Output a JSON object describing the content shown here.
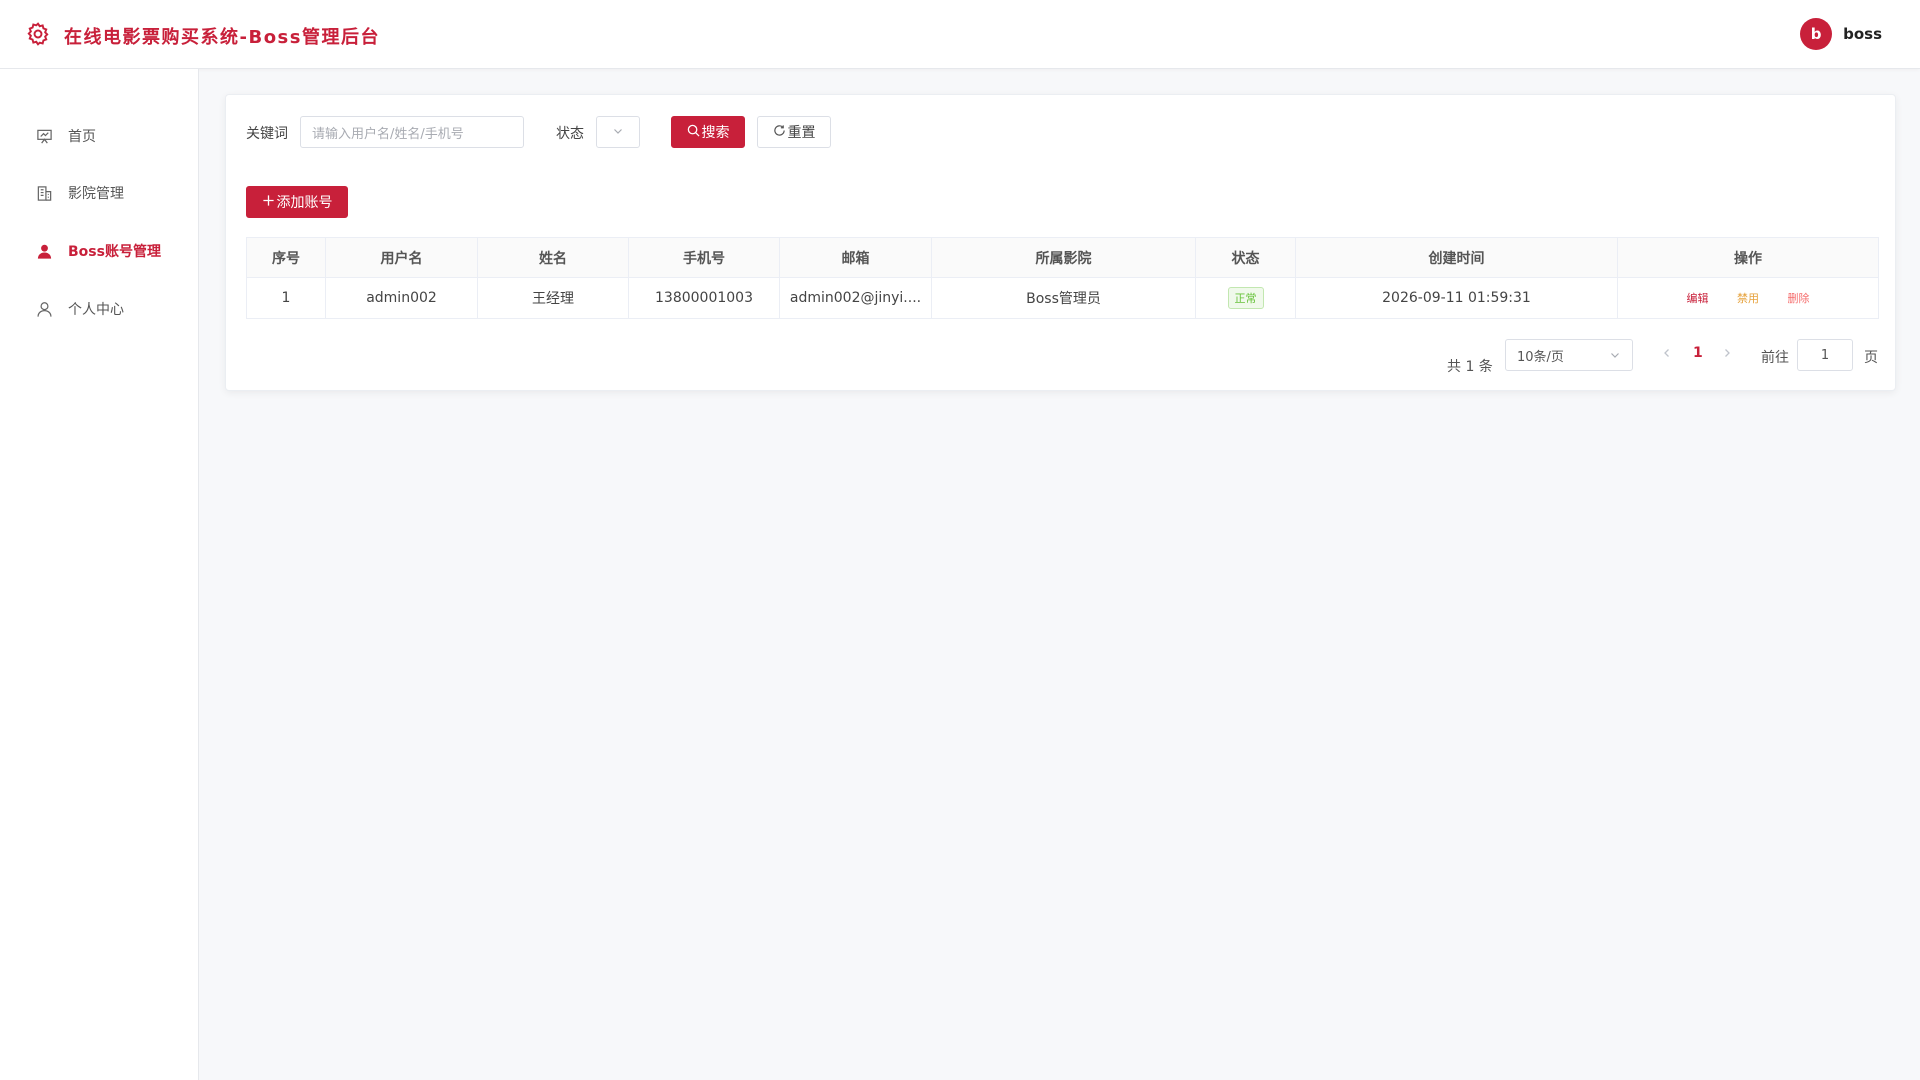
{
  "header": {
    "title": "在线电影票购买系统-Boss管理后台",
    "user": {
      "avatar_letter": "b",
      "name": "boss"
    }
  },
  "sidebar": {
    "items": [
      {
        "label": "首页",
        "icon": "presentation-icon",
        "active": false
      },
      {
        "label": "影院管理",
        "icon": "building-icon",
        "active": false
      },
      {
        "label": "Boss账号管理",
        "icon": "user-filled-icon",
        "active": true
      },
      {
        "label": "个人中心",
        "icon": "user-outline-icon",
        "active": false
      }
    ]
  },
  "filters": {
    "keyword_label": "关键词",
    "keyword_placeholder": "请输入用户名/姓名/手机号",
    "status_label": "状态",
    "search_label": "搜索",
    "reset_label": "重置"
  },
  "toolbar": {
    "add_label": "添加账号"
  },
  "table": {
    "columns": [
      "序号",
      "用户名",
      "姓名",
      "手机号",
      "邮箱",
      "所属影院",
      "状态",
      "创建时间",
      "操作"
    ],
    "rows": [
      {
        "index": "1",
        "username": "admin002",
        "name": "王经理",
        "phone": "13800001003",
        "email": "admin002@jinyi....",
        "cinema": "Boss管理员",
        "status": "正常",
        "created": "2026-09-11 01:59:31",
        "actions": {
          "edit": "编辑",
          "disable": "禁用",
          "delete": "删除"
        }
      }
    ]
  },
  "pagination": {
    "total": "共 1 条",
    "page_size": "10条/页",
    "current_page": "1",
    "goto_label": "前往",
    "goto_value": "1",
    "page_suffix": "页"
  },
  "colors": {
    "accent": "#c8203a",
    "success": "#67c23a",
    "warning": "#e6a23c",
    "danger": "#f56c6c"
  }
}
